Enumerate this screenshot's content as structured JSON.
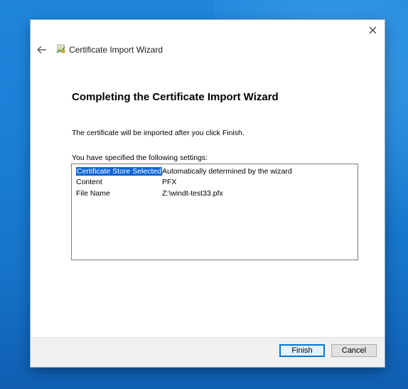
{
  "wizard": {
    "title": "Certificate Import Wizard",
    "heading": "Completing the Certificate Import Wizard",
    "info_text": "The certificate will be imported after you click Finish.",
    "settings_label": "You have specified the following settings:",
    "settings": [
      {
        "key": "Certificate Store Selected",
        "value": "Automatically determined by the wizard"
      },
      {
        "key": "Content",
        "value": "PFX"
      },
      {
        "key": "File Name",
        "value": "Z:\\windt-test33.pfx"
      }
    ]
  },
  "buttons": {
    "finish_label": "Finish",
    "cancel_label": "Cancel"
  },
  "icons": {
    "close": "close-icon",
    "back": "back-arrow-icon",
    "wizard": "certificate-icon"
  },
  "colors": {
    "accent": "#0078d7",
    "selection": "#0a64d8",
    "desktop": "#1b7fd6"
  }
}
